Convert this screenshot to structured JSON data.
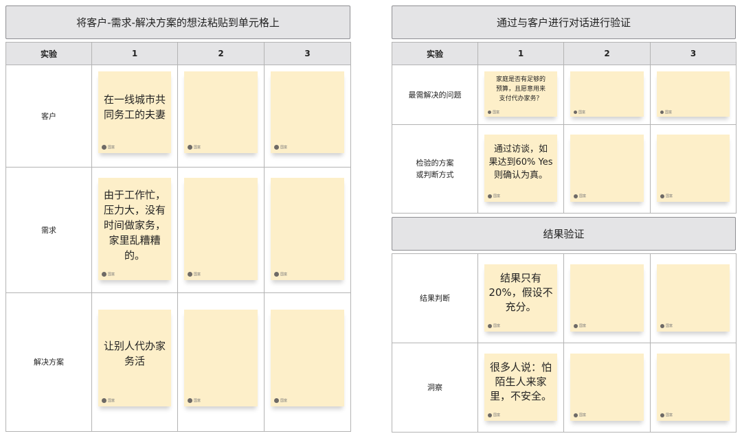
{
  "left": {
    "title": "将客户-需求-解决方案的想法粘贴到单元格上",
    "columns": [
      "实验",
      "1",
      "2",
      "3"
    ],
    "rows": [
      {
        "label": "客户",
        "notes": [
          "在一线城市共\n同务工的夫妻",
          "",
          ""
        ]
      },
      {
        "label": "需求",
        "notes": [
          "由于工作忙，\n压力大，没有\n时间做家务，\n家里乱糟糟\n的。",
          "",
          ""
        ]
      },
      {
        "label": "解决方案",
        "notes": [
          "让别人代办家\n务活",
          "",
          ""
        ]
      }
    ]
  },
  "right_top": {
    "title": "通过与客户进行对话进行验证",
    "columns": [
      "实验",
      "1",
      "2",
      "3"
    ],
    "rows": [
      {
        "label": "最需解决的问题",
        "notes": [
          "家庭是否有足够的\n预算，且愿意用来\n支付代办家务？",
          "",
          ""
        ]
      },
      {
        "label": "检验的方案\n或判断方式",
        "notes": [
          "通过访谈，如\n果达到60% Yes\n则确认为真。",
          "",
          ""
        ]
      }
    ]
  },
  "right_bottom": {
    "title": "结果验证",
    "rows": [
      {
        "label": "结果判断",
        "notes": [
          "结果只有\n20%，假设不\n充分。",
          "",
          ""
        ]
      },
      {
        "label": "洞察",
        "notes": [
          "很多人说：怕\n陌生人来家\n里，不安全。",
          "",
          ""
        ]
      }
    ]
  },
  "note_author": "国富",
  "colors": {
    "note": "#fdefc9",
    "header": "#e4e4e6",
    "border": "#b3b3b3"
  }
}
